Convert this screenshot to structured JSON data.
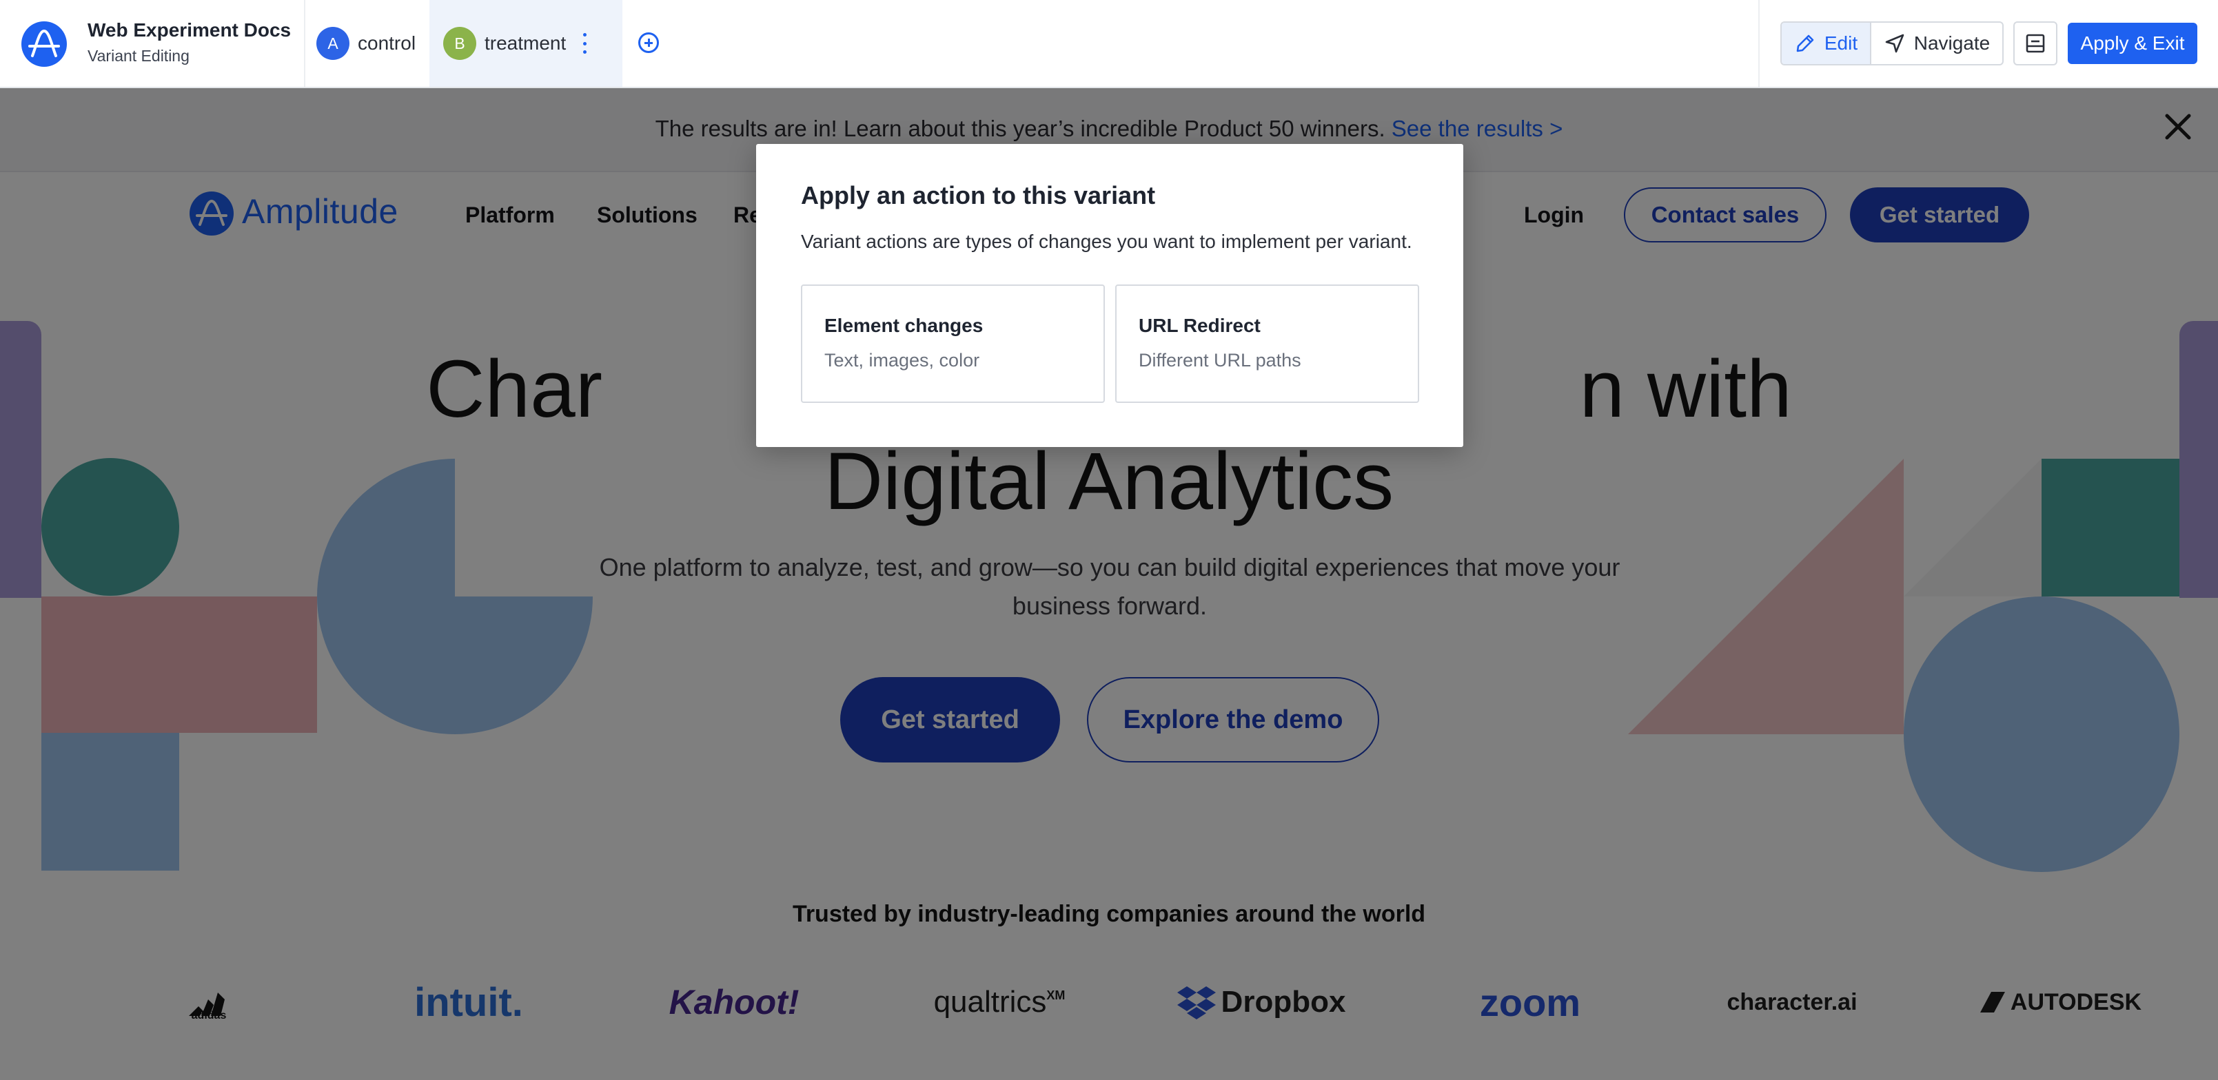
{
  "editor": {
    "title": "Web Experiment Docs",
    "subtitle": "Variant Editing",
    "variants": [
      {
        "badge": "A",
        "label": "control",
        "color": "#2d64e6"
      },
      {
        "badge": "B",
        "label": "treatment",
        "color": "#8bb34a"
      }
    ],
    "modes": {
      "edit": "Edit",
      "navigate": "Navigate"
    },
    "apply_label": "Apply & Exit",
    "accent": "#1e61f0"
  },
  "site": {
    "announcement": {
      "text": "The results are in! Learn about this year’s incredible Product 50 winners.",
      "link": "See the results >"
    },
    "brand": "Amplitude",
    "nav": [
      "Platform",
      "Solutions",
      "Re"
    ],
    "login": "Login",
    "contact": "Contact sales",
    "get_started": "Get started",
    "hero": {
      "line1": "Char                                                            n with",
      "line2": "Digital Analytics",
      "subtitle": "One platform to analyze, test, and grow—so you can build digital experiences that move your business forward.",
      "cta_primary": "Get started",
      "cta_secondary": "Explore the demo"
    },
    "trusted": "Trusted by industry-leading companies around the world",
    "logos": [
      "adidas",
      "intuit.",
      "Kahoot!",
      "qualtrics",
      "XM",
      "Dropbox",
      "zoom",
      "character.ai",
      "AUTODESK"
    ],
    "brand_color": "#1e3fbd"
  },
  "modal": {
    "title": "Apply an action to this variant",
    "description": "Variant actions are types of changes you want to implement per variant.",
    "options": [
      {
        "title": "Element changes",
        "subtitle": "Text, images, color"
      },
      {
        "title": "URL Redirect",
        "subtitle": "Different URL paths"
      }
    ]
  },
  "icons": {
    "app_logo": "amplitude-logo-icon",
    "add_variant": "plus-circle-icon",
    "edit": "pencil-icon",
    "navigate": "navigation-arrow-icon",
    "panel": "panel-toggle-icon",
    "close": "close-icon"
  }
}
